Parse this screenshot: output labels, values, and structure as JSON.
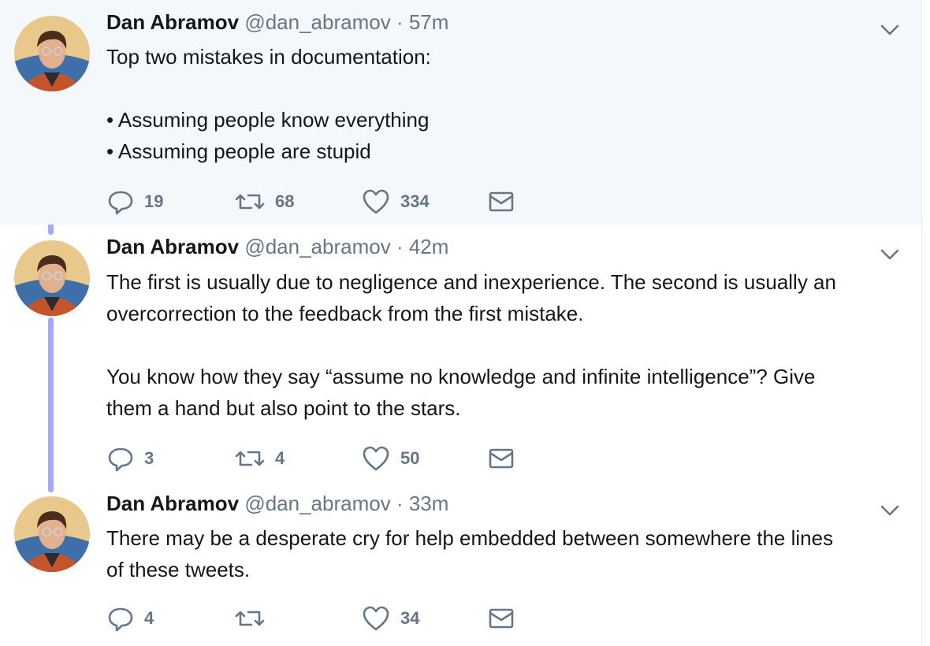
{
  "tweets": [
    {
      "name": "Dan Abramov",
      "handle": "@dan_abramov",
      "sep": "·",
      "time": "57m",
      "body": [
        "Top two mistakes in documentation:",
        "",
        "• Assuming people know everything",
        "• Assuming people are stupid"
      ],
      "replies": "19",
      "retweets": "68",
      "likes": "334"
    },
    {
      "name": "Dan Abramov",
      "handle": "@dan_abramov",
      "sep": "·",
      "time": "42m",
      "body": [
        "The first is usually due to negligence and inexperience. The second is usually an",
        "overcorrection to the feedback from the first mistake.",
        "",
        "You know how they say “assume no knowledge and infinite intelligence”? Give",
        "them a hand but also point to the stars."
      ],
      "replies": "3",
      "retweets": "4",
      "likes": "50"
    },
    {
      "name": "Dan Abramov",
      "handle": "@dan_abramov",
      "sep": "·",
      "time": "33m",
      "body": [
        "There may be a desperate cry for help embedded between somewhere the lines",
        "of these tweets."
      ],
      "replies": "4",
      "retweets": "",
      "likes": "34"
    }
  ],
  "icons": {
    "reply": "reply-icon",
    "retweet": "retweet-icon",
    "like": "heart-icon",
    "message": "envelope-icon",
    "more": "chevron-down-icon"
  },
  "colors": {
    "thread_line": "#a5a8fb",
    "icon_gray": "#657786",
    "highlight_bg": "#f5f8fa"
  }
}
